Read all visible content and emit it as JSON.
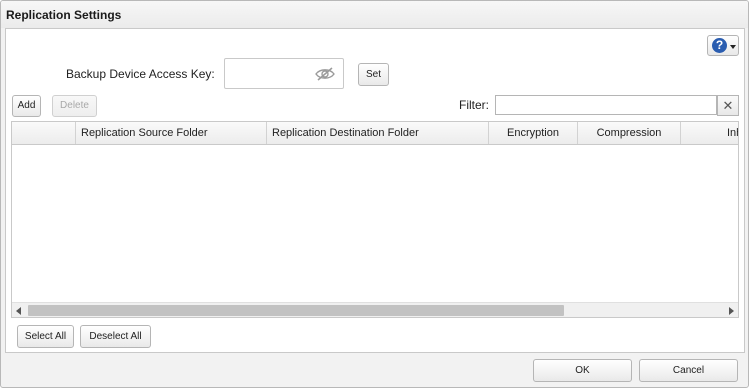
{
  "window": {
    "title": "Replication Settings",
    "help_icon_glyph": "?"
  },
  "form": {
    "access_key_label": "Backup Device Access Key:",
    "access_key_value": "",
    "set_label": "Set"
  },
  "toolbar": {
    "add_label": "Add",
    "delete_label": "Delete",
    "filter_label": "Filter:",
    "filter_value": "",
    "clear_glyph": "✕"
  },
  "table": {
    "columns": [
      "",
      "Replication Source Folder",
      "Replication Destination Folder",
      "Encryption",
      "Compression",
      "Inh"
    ],
    "rows": []
  },
  "selection": {
    "select_all_label": "Select All",
    "deselect_all_label": "Deselect All"
  },
  "footer": {
    "ok_label": "OK",
    "cancel_label": "Cancel"
  },
  "colors": {
    "help_blue": "#2a5db0",
    "panel_bg": "#ffffff",
    "dialog_bg": "#f2f2f2"
  }
}
